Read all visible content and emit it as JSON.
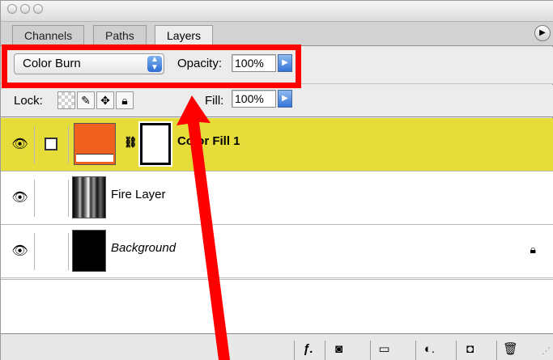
{
  "tabs": [
    {
      "label": "Channels",
      "active": false
    },
    {
      "label": "Paths",
      "active": false
    },
    {
      "label": "Layers",
      "active": true
    }
  ],
  "blend_mode": {
    "value": "Color Burn"
  },
  "opacity": {
    "label": "Opacity:",
    "value": "100%"
  },
  "lock": {
    "label": "Lock:"
  },
  "fill": {
    "label": "Fill:",
    "value": "100%"
  },
  "layers": [
    {
      "name": "Color Fill 1",
      "selected": true,
      "italic": false,
      "color": "#f0601e"
    },
    {
      "name": "Fire Layer",
      "selected": false,
      "italic": false
    },
    {
      "name": "Background",
      "selected": false,
      "italic": true,
      "locked": true
    }
  ],
  "colors": {
    "selection": "#e6dd3a",
    "annotation": "#ff0000",
    "fill_swatch": "#f0601e"
  },
  "icons": [
    "eye-icon",
    "chain-link-icon",
    "lock-icon",
    "layer-style-icon",
    "mask-icon",
    "folder-icon",
    "adjustment-layer-icon",
    "new-layer-icon",
    "trash-icon"
  ]
}
